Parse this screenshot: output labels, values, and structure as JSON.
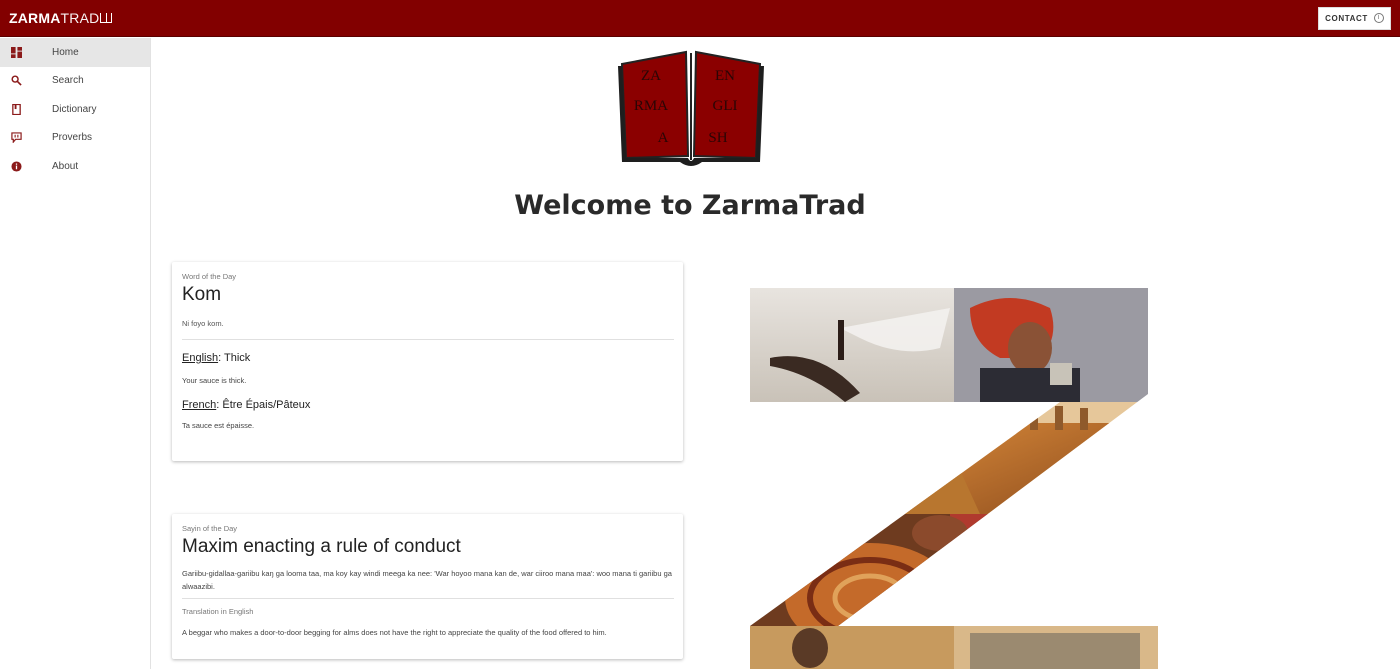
{
  "header": {
    "brand_bold": "ZARMA",
    "brand_light": "TRAD",
    "contact_label": "CONTACT"
  },
  "sidebar": {
    "items": [
      {
        "label": "Home",
        "icon": "dashboard-icon",
        "active": true
      },
      {
        "label": "Search",
        "icon": "search-icon",
        "active": false
      },
      {
        "label": "Dictionary",
        "icon": "book-icon",
        "active": false
      },
      {
        "label": "Proverbs",
        "icon": "comment-icon",
        "active": false
      },
      {
        "label": "About",
        "icon": "info-icon",
        "active": false
      }
    ]
  },
  "logo": {
    "letters": [
      "ZA",
      "EN",
      "RMA",
      "GLI",
      "A",
      "SH"
    ]
  },
  "main": {
    "title": "Welcome to ZarmaTrad"
  },
  "word_card": {
    "overline": "Word of the Day",
    "word": "Kom",
    "example_zarma": "Ni foyo kom.",
    "english_label": "English",
    "english_value": ": Thick",
    "english_example": "Your sauce is thick.",
    "french_label": "French",
    "french_value": ": Être Épais/Pâteux",
    "french_example": "Ta sauce est épaisse."
  },
  "saying_card": {
    "overline": "Sayin of the Day",
    "title": "Maxim enacting a rule of conduct",
    "text": "Gariibu-gidallaa-gariibu kaŋ ga looma taa, ma koy kay windi meega ka nee: 'War hoyoo mana kan de, war ciiroo mana maa': woo mana ti gariibu ga alwaazibi.",
    "translation_label": "Translation in English",
    "translation": "A beggar who makes a door-to-door begging for alms does not have the right to appreciate the quality of the food offered to him."
  },
  "colors": {
    "accent": "#820000",
    "logo_red": "#8b0000"
  }
}
